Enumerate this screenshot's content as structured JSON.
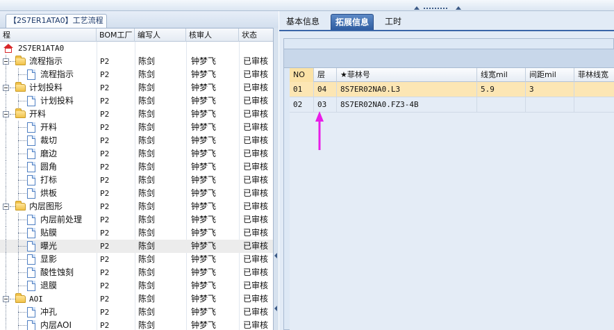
{
  "left_panel": {
    "tab_title": "【2S7ER1ATA0】工艺流程",
    "columns": [
      "程",
      "BOM工厂",
      "编写人",
      "核审人",
      "状态"
    ],
    "rows": [
      {
        "name": "2S7ER1ATA0",
        "level": 0,
        "type": "root",
        "bom": "",
        "author": "",
        "reviewer": "",
        "status": ""
      },
      {
        "name": "流程指示",
        "level": 1,
        "type": "folder",
        "bom": "P2",
        "author": "陈剑",
        "reviewer": "钟梦飞",
        "status": "已审核"
      },
      {
        "name": "流程指示",
        "level": 2,
        "type": "doc",
        "bom": "P2",
        "author": "陈剑",
        "reviewer": "钟梦飞",
        "status": "已审核"
      },
      {
        "name": "计划投料",
        "level": 1,
        "type": "folder",
        "bom": "P2",
        "author": "陈剑",
        "reviewer": "钟梦飞",
        "status": "已审核"
      },
      {
        "name": "计划投料",
        "level": 2,
        "type": "doc",
        "bom": "P2",
        "author": "陈剑",
        "reviewer": "钟梦飞",
        "status": "已审核"
      },
      {
        "name": "开料",
        "level": 1,
        "type": "folder",
        "bom": "P2",
        "author": "陈剑",
        "reviewer": "钟梦飞",
        "status": "已审核"
      },
      {
        "name": "开料",
        "level": 2,
        "type": "doc",
        "bom": "P2",
        "author": "陈剑",
        "reviewer": "钟梦飞",
        "status": "已审核"
      },
      {
        "name": "裁切",
        "level": 2,
        "type": "doc",
        "bom": "P2",
        "author": "陈剑",
        "reviewer": "钟梦飞",
        "status": "已审核"
      },
      {
        "name": "磨边",
        "level": 2,
        "type": "doc",
        "bom": "P2",
        "author": "陈剑",
        "reviewer": "钟梦飞",
        "status": "已审核"
      },
      {
        "name": "圆角",
        "level": 2,
        "type": "doc",
        "bom": "P2",
        "author": "陈剑",
        "reviewer": "钟梦飞",
        "status": "已审核"
      },
      {
        "name": "打标",
        "level": 2,
        "type": "doc",
        "bom": "P2",
        "author": "陈剑",
        "reviewer": "钟梦飞",
        "status": "已审核"
      },
      {
        "name": "烘板",
        "level": 2,
        "type": "doc",
        "bom": "P2",
        "author": "陈剑",
        "reviewer": "钟梦飞",
        "status": "已审核"
      },
      {
        "name": "内层图形",
        "level": 1,
        "type": "folder",
        "bom": "P2",
        "author": "陈剑",
        "reviewer": "钟梦飞",
        "status": "已审核"
      },
      {
        "name": "内层前处理",
        "level": 2,
        "type": "doc",
        "bom": "P2",
        "author": "陈剑",
        "reviewer": "钟梦飞",
        "status": "已审核"
      },
      {
        "name": "贴膜",
        "level": 2,
        "type": "doc",
        "bom": "P2",
        "author": "陈剑",
        "reviewer": "钟梦飞",
        "status": "已审核"
      },
      {
        "name": "曝光",
        "level": 2,
        "type": "doc",
        "bom": "P2",
        "author": "陈剑",
        "reviewer": "钟梦飞",
        "status": "已审核",
        "selected": true
      },
      {
        "name": "显影",
        "level": 2,
        "type": "doc",
        "bom": "P2",
        "author": "陈剑",
        "reviewer": "钟梦飞",
        "status": "已审核"
      },
      {
        "name": "酸性蚀刻",
        "level": 2,
        "type": "doc",
        "bom": "P2",
        "author": "陈剑",
        "reviewer": "钟梦飞",
        "status": "已审核"
      },
      {
        "name": "退膜",
        "level": 2,
        "type": "doc",
        "bom": "P2",
        "author": "陈剑",
        "reviewer": "钟梦飞",
        "status": "已审核"
      },
      {
        "name": "AOI",
        "level": 1,
        "type": "folder",
        "bom": "P2",
        "author": "陈剑",
        "reviewer": "钟梦飞",
        "status": "已审核"
      },
      {
        "name": "冲孔",
        "level": 2,
        "type": "doc",
        "bom": "P2",
        "author": "陈剑",
        "reviewer": "钟梦飞",
        "status": "已审核"
      },
      {
        "name": "内层AOI",
        "level": 2,
        "type": "doc",
        "bom": "P2",
        "author": "陈剑",
        "reviewer": "钟梦飞",
        "status": "已审核"
      }
    ]
  },
  "right_panel": {
    "tabs": [
      {
        "label": "基本信息",
        "active": false
      },
      {
        "label": "拓展信息",
        "active": true
      },
      {
        "label": "工时",
        "active": false
      }
    ],
    "film_table": {
      "columns": [
        "NO",
        "层",
        "★菲林号",
        "线宽mil",
        "间距mil",
        "菲林线宽"
      ],
      "rows": [
        {
          "no": "01",
          "layer": "04",
          "film": "8S7ER02NA0.L3",
          "width": "5.9",
          "spacing": "3",
          "film_width": "",
          "selected": true
        },
        {
          "no": "02",
          "layer": "03",
          "film": "8S7ER02NA0.FZ3-4B",
          "width": "",
          "spacing": "",
          "film_width": "",
          "selected": false
        }
      ]
    }
  },
  "colors": {
    "accent": "#3a66a8",
    "selected_row": "#fce6b4",
    "annotation_arrow": "#e81ee8"
  }
}
